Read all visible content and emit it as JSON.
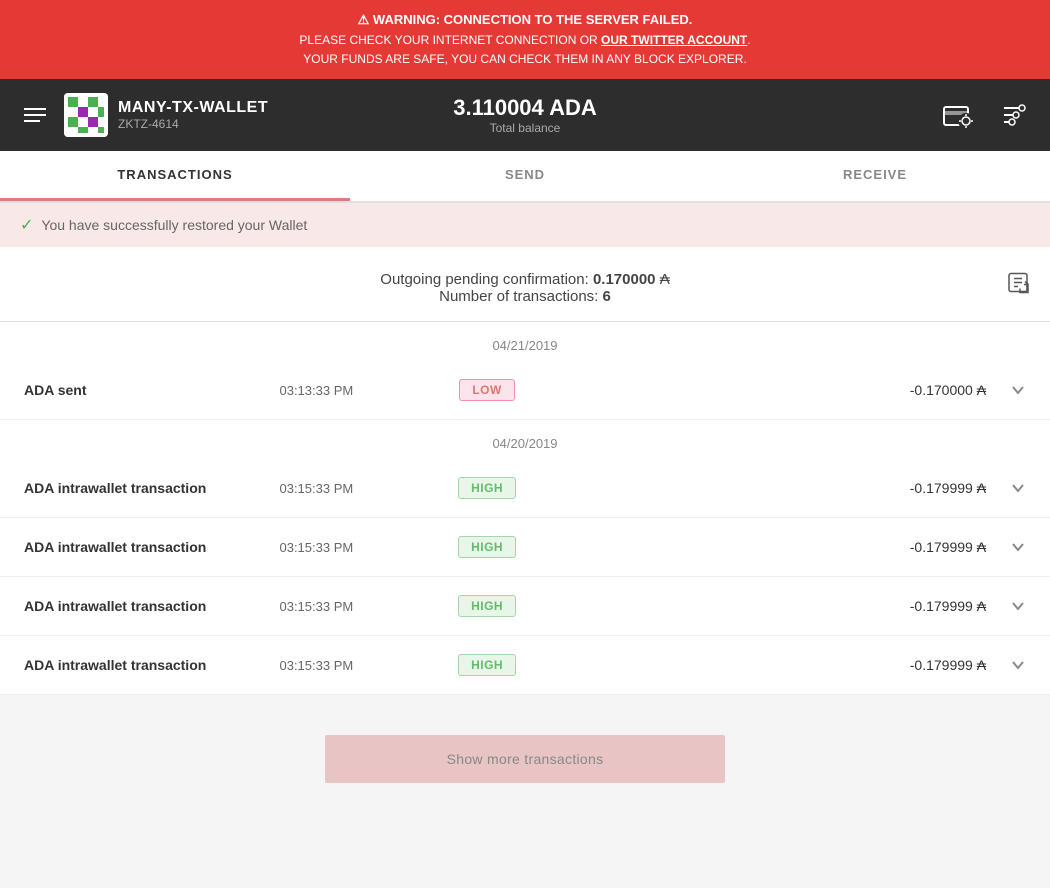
{
  "warning": {
    "icon": "⚠",
    "line1": "WARNING: CONNECTION TO THE SERVER FAILED.",
    "line2": "PLEASE CHECK YOUR INTERNET CONNECTION OR OUR TWITTER ACCOUNT.",
    "line3": "YOUR FUNDS ARE SAFE, YOU CAN CHECK THEM IN ANY BLOCK EXPLORER.",
    "twitter_text": "OUR TWITTER ACCOUNT"
  },
  "header": {
    "wallet_name": "MANY-TX-WALLET",
    "wallet_id": "ZKTZ-4614",
    "balance": "3.110004 ADA",
    "balance_label": "Total balance"
  },
  "nav": {
    "tabs": [
      {
        "label": "TRANSACTIONS",
        "active": true
      },
      {
        "label": "SEND",
        "active": false
      },
      {
        "label": "RECEIVE",
        "active": false
      }
    ]
  },
  "success_banner": {
    "message": "You have successfully restored your Wallet"
  },
  "pending": {
    "label": "Outgoing pending confirmation:",
    "amount": "0.170000",
    "ada_symbol": "₳",
    "tx_label": "Number of transactions:",
    "tx_count": "6"
  },
  "date_groups": [
    {
      "date": "04/21/2019",
      "transactions": [
        {
          "title": "ADA sent",
          "time": "03:13:33 PM",
          "badge": "LOW",
          "badge_type": "low",
          "amount": "-0.170000 ₳"
        }
      ]
    },
    {
      "date": "04/20/2019",
      "transactions": [
        {
          "title": "ADA intrawallet transaction",
          "time": "03:15:33 PM",
          "badge": "HIGH",
          "badge_type": "high",
          "amount": "-0.179999 ₳"
        },
        {
          "title": "ADA intrawallet transaction",
          "time": "03:15:33 PM",
          "badge": "HIGH",
          "badge_type": "high",
          "amount": "-0.179999 ₳"
        },
        {
          "title": "ADA intrawallet transaction",
          "time": "03:15:33 PM",
          "badge": "HIGH",
          "badge_type": "high",
          "amount": "-0.179999 ₳"
        },
        {
          "title": "ADA intrawallet transaction",
          "time": "03:15:33 PM",
          "badge": "HIGH",
          "badge_type": "high",
          "amount": "-0.179999 ₳"
        }
      ]
    }
  ],
  "show_more_btn": "Show more transactions"
}
